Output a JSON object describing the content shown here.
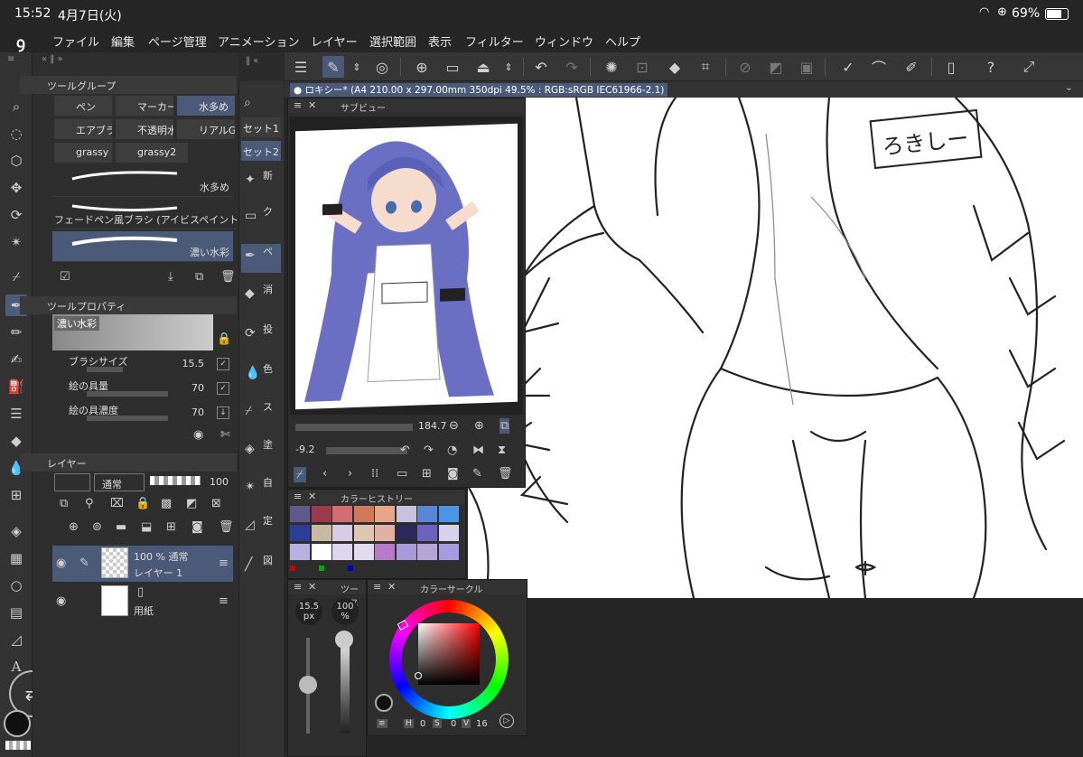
{
  "status": {
    "time": "15:52",
    "date": "4月7日(火)",
    "battery": "69%"
  },
  "menu": [
    "ファイル",
    "編集",
    "ページ管理",
    "アニメーション",
    "レイヤー",
    "選択範囲",
    "表示",
    "フィルター",
    "ウィンドウ",
    "ヘルプ"
  ],
  "document": {
    "title": "● ロキシー* (A4 210.00 x 297.00mm 350dpi 49.5% : RGB:sRGB IEC61966-2.1)"
  },
  "toolGroup": {
    "title": "ツールグループ",
    "subtools": [
      "ペン",
      "マーカー",
      "水多め",
      "エアブラ",
      "不透明水",
      "リアルG",
      "grassy",
      "grassy2"
    ],
    "brushes": [
      "水多め",
      "フェードペン風ブラシ (アイビスペイント",
      "濃い水彩"
    ]
  },
  "toolProperty": {
    "title": "ツールプロパティ",
    "preset": "濃い水彩",
    "props": [
      {
        "label": "ブラシサイズ",
        "value": "15.5"
      },
      {
        "label": "絵の具量",
        "value": "70"
      },
      {
        "label": "絵の具濃度",
        "value": "70"
      }
    ]
  },
  "layerPanel": {
    "title": "レイヤー",
    "blend": "通常",
    "opacity": "100",
    "layers": [
      {
        "line1": "100 % 通常",
        "line2": "レイヤー 1"
      },
      {
        "line1": "",
        "line2": "用紙"
      }
    ]
  },
  "sets": [
    "セット1",
    "セット2"
  ],
  "setItems": [
    "新",
    "ク",
    "ペ",
    "消",
    "投",
    "色",
    "ス",
    "塗",
    "自",
    "定",
    "図"
  ],
  "subview": {
    "title": "サブビュー",
    "zoom": "184.7",
    "rotation": "-9.2"
  },
  "history": {
    "title": "カラーヒストリー",
    "colors": [
      "#5f5a8a",
      "#9a3a4a",
      "#d46c74",
      "#d07a5a",
      "#e8a58a",
      "#c9c4dc",
      "#5a86d6",
      "#4a96e6",
      "#2a3e9a",
      "#c8b8a0",
      "#d8cce4",
      "#e0c6b0",
      "#e4b0a6",
      "#2a2a5a",
      "#6a64c0",
      "#d6d2ea",
      "#b8b0e0",
      "#ffffff",
      "#ddd6ee",
      "#e0dcee",
      "#b67ac8",
      "#a89ad8",
      "#b6a6d6",
      "#a89ae0"
    ]
  },
  "toolsize": {
    "title": "ツールス",
    "size": "15.5",
    "unit": "px",
    "opacity": "100",
    "opunit": "%"
  },
  "colorCircle": {
    "title": "カラーサークル",
    "h": "0",
    "s": "0",
    "v": "16"
  },
  "canvasLabel": "ろきしー"
}
